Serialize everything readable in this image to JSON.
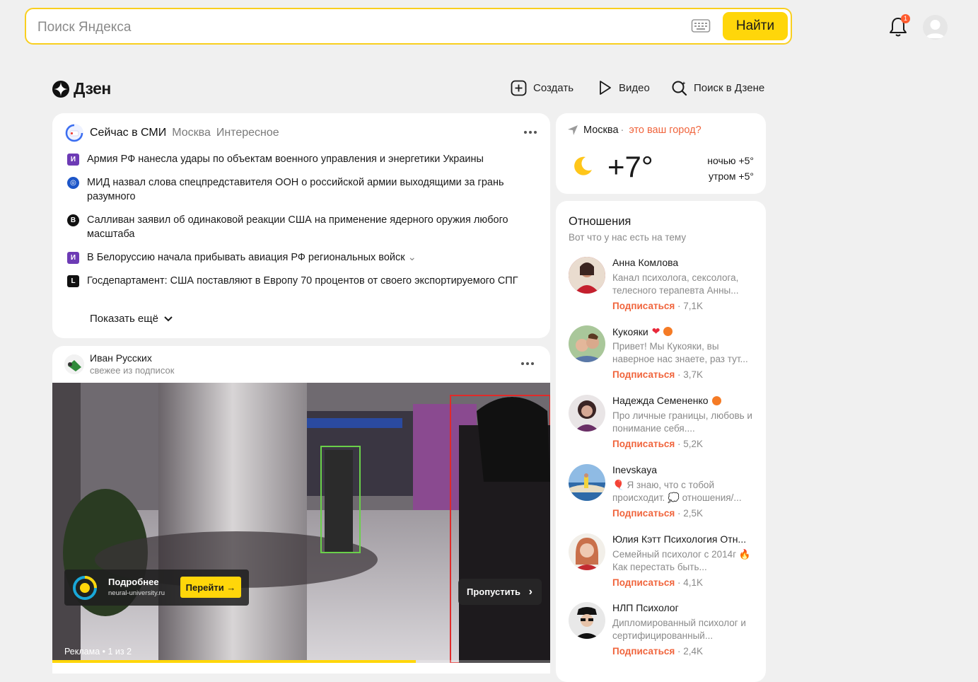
{
  "search": {
    "placeholder": "Поиск Яндекса",
    "button": "Найти"
  },
  "notifications": {
    "badge": "1"
  },
  "dzen": {
    "title": "Дзен",
    "nav": [
      {
        "icon": "create-icon",
        "label": "Создать"
      },
      {
        "icon": "video-icon",
        "label": "Видео"
      },
      {
        "icon": "search-dzen-icon",
        "label": "Поиск в Дзене"
      }
    ]
  },
  "news": {
    "title": "Сейчас в СМИ",
    "tabs": [
      "Москва",
      "Интересное"
    ],
    "items": [
      {
        "source_icon": "izvestia-icon",
        "source_color": "#6d3bb5",
        "text": "Армия РФ нанесла удары по объектам военного управления и энергетики Украины"
      },
      {
        "source_icon": "globe-source-icon",
        "source_color": "#1d56c8",
        "text": "МИД назвал слова спецпредставителя ООН о российской армии выходящими за грань разумного"
      },
      {
        "source_icon": "vedomosti-icon",
        "source_color": "#111111",
        "text": "Салливан заявил об одинаковой реакции США на применение ядерного оружия любого масштаба"
      },
      {
        "source_icon": "izvestia-icon",
        "source_color": "#6d3bb5",
        "text": "В Белоруссию начала прибывать авиация РФ региональных войск"
      },
      {
        "source_icon": "lenta-icon",
        "source_color": "#111111",
        "text": "Госдепартамент: США поставляют в Европу 70 процентов от своего экспортируемого СПГ"
      }
    ],
    "show_more": "Показать ещё"
  },
  "post": {
    "author": "Иван Русских",
    "subtitle": "свежее из подписок",
    "ad": {
      "title": "Подробнее",
      "url": "neural-university.ru",
      "button": "Перейти"
    },
    "skip": "Пропустить",
    "ad_label": "Реклама • 1 из 2",
    "progress_fraction": 0.73
  },
  "weather": {
    "city": "Москва",
    "question": "это ваш город?",
    "temp": "+7°",
    "night": "ночью +5°",
    "morning": "утром +5°"
  },
  "channels": {
    "title": "Отношения",
    "subtitle": "Вот что у нас есть на тему",
    "subscribe_label": "Подписаться",
    "items": [
      {
        "name": "Анна Комлова",
        "desc": "Канал психолога, сексолога, телесного терапевта Анны...",
        "count": "7,1K",
        "color": "#b8293a"
      },
      {
        "name": "Кукояки",
        "desc": "Привет! Мы Кукояки, вы наверное нас знаете, раз тут...",
        "count": "3,7K",
        "color": "#6a8a5a"
      },
      {
        "name": "Надежда Семененко",
        "desc": "Про личные границы, любовь и понимание себя....",
        "count": "5,2K",
        "color": "#6b4a5a"
      },
      {
        "name": "Inevskaya",
        "desc": "🎈 Я знаю, что с тобой происходит. 💭 отношения/...",
        "count": "2,5K",
        "color": "#4f7fb0"
      },
      {
        "name": "Юлия Кэтт Психология Отн...",
        "desc": "Семейный психолог с 2014г 🔥 Как перестать быть...",
        "count": "4,1K",
        "color": "#c9704b"
      },
      {
        "name": "НЛП Психолог",
        "desc": "Дипломированный психолог и сертифицированный...",
        "count": "2,4K",
        "color": "#333333"
      }
    ]
  }
}
